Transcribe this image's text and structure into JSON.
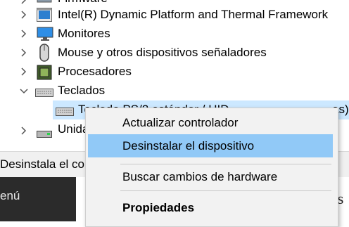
{
  "tree": {
    "items": [
      {
        "label": "Firmware",
        "icon": "firmware-icon",
        "expanded": false
      },
      {
        "label": "Intel(R) Dynamic Platform and Thermal Framework",
        "icon": "device-icon",
        "expanded": false
      },
      {
        "label": "Monitores",
        "icon": "monitor-icon",
        "expanded": false
      },
      {
        "label": "Mouse y otros dispositivos señaladores",
        "icon": "mouse-icon",
        "expanded": false
      },
      {
        "label": "Procesadores",
        "icon": "processor-icon",
        "expanded": false
      },
      {
        "label": "Teclados",
        "icon": "keyboard-icon",
        "expanded": true
      },
      {
        "label": "Teclado PS/2 estándar / HID",
        "icon": "keyboard-icon",
        "selected": true
      },
      {
        "label": "Unidades de disco",
        "icon": "disk-icon",
        "expanded": false
      }
    ],
    "child_suffix": "as)"
  },
  "context_menu": {
    "items": [
      {
        "label": "Actualizar controlador"
      },
      {
        "label": "Desinstalar el dispositivo",
        "highlighted": true
      },
      {
        "label": "Buscar cambios de hardware"
      },
      {
        "label": "Propiedades",
        "bold": true
      }
    ]
  },
  "status_bar": {
    "text": "Desinstala el controlador del dispositivo seleccionado."
  },
  "bottom": {
    "menu_fragment": "enú",
    "right_fragment": "as"
  },
  "colors": {
    "highlight": "#91c9f7",
    "selection": "#cce8ff",
    "menu_bg": "#f2f2f2"
  }
}
